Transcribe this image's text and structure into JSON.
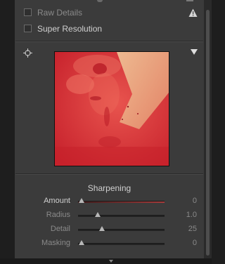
{
  "detail_options": {
    "raw_details_label": "Raw Details",
    "super_resolution_label": "Super Resolution"
  },
  "icons": {
    "warning": "warning-icon",
    "target": "target-icon",
    "expand": "triangle-down-icon"
  },
  "sharpening": {
    "title": "Sharpening",
    "sliders": [
      {
        "label": "Amount",
        "value": "0",
        "position": 0.0
      },
      {
        "label": "Radius",
        "value": "1.0",
        "position": 0.23
      },
      {
        "label": "Detail",
        "value": "25",
        "position": 0.25
      },
      {
        "label": "Masking",
        "value": "0",
        "position": 0.0
      }
    ]
  },
  "colors": {
    "panel": "#3b3b3b",
    "preview_tint": "#d8323a",
    "amount_track": "#a43a3a"
  }
}
